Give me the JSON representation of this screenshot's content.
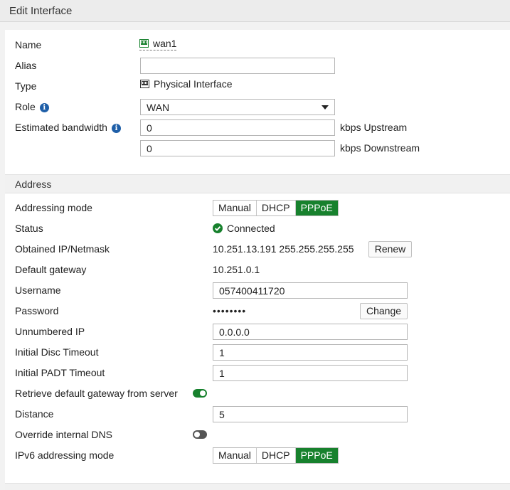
{
  "window": {
    "title": "Edit Interface"
  },
  "general": {
    "name_label": "Name",
    "name_value": "wan1",
    "alias_label": "Alias",
    "alias_value": "",
    "type_label": "Type",
    "type_value": "Physical Interface",
    "role_label": "Role",
    "role_value": "WAN",
    "bandwidth_label": "Estimated bandwidth",
    "upstream_value": "0",
    "upstream_unit": "kbps Upstream",
    "downstream_value": "0",
    "downstream_unit": "kbps Downstream"
  },
  "address": {
    "section_title": "Address",
    "mode_label": "Addressing mode",
    "mode_options": [
      "Manual",
      "DHCP",
      "PPPoE"
    ],
    "mode_selected": "PPPoE",
    "status_label": "Status",
    "status_value": "Connected",
    "ip_label": "Obtained IP/Netmask",
    "ip_value": "10.251.13.191 255.255.255.255",
    "renew_label": "Renew",
    "gateway_label": "Default gateway",
    "gateway_value": "10.251.0.1",
    "username_label": "Username",
    "username_value": "057400411720",
    "password_label": "Password",
    "password_value": "••••••••",
    "change_label": "Change",
    "unnumbered_label": "Unnumbered IP",
    "unnumbered_value": "0.0.0.0",
    "disc_timeout_label": "Initial Disc Timeout",
    "disc_timeout_value": "1",
    "padt_timeout_label": "Initial PADT Timeout",
    "padt_timeout_value": "1",
    "retrieve_gw_label": "Retrieve default gateway from server",
    "retrieve_gw_enabled": true,
    "distance_label": "Distance",
    "distance_value": "5",
    "override_dns_label": "Override internal DNS",
    "override_dns_enabled": false,
    "ipv6_mode_label": "IPv6 addressing mode",
    "ipv6_mode_options": [
      "Manual",
      "DHCP",
      "PPPoE"
    ],
    "ipv6_mode_selected": "PPPoE"
  },
  "colors": {
    "accent": "#17812d",
    "info": "#1f5fa8"
  }
}
